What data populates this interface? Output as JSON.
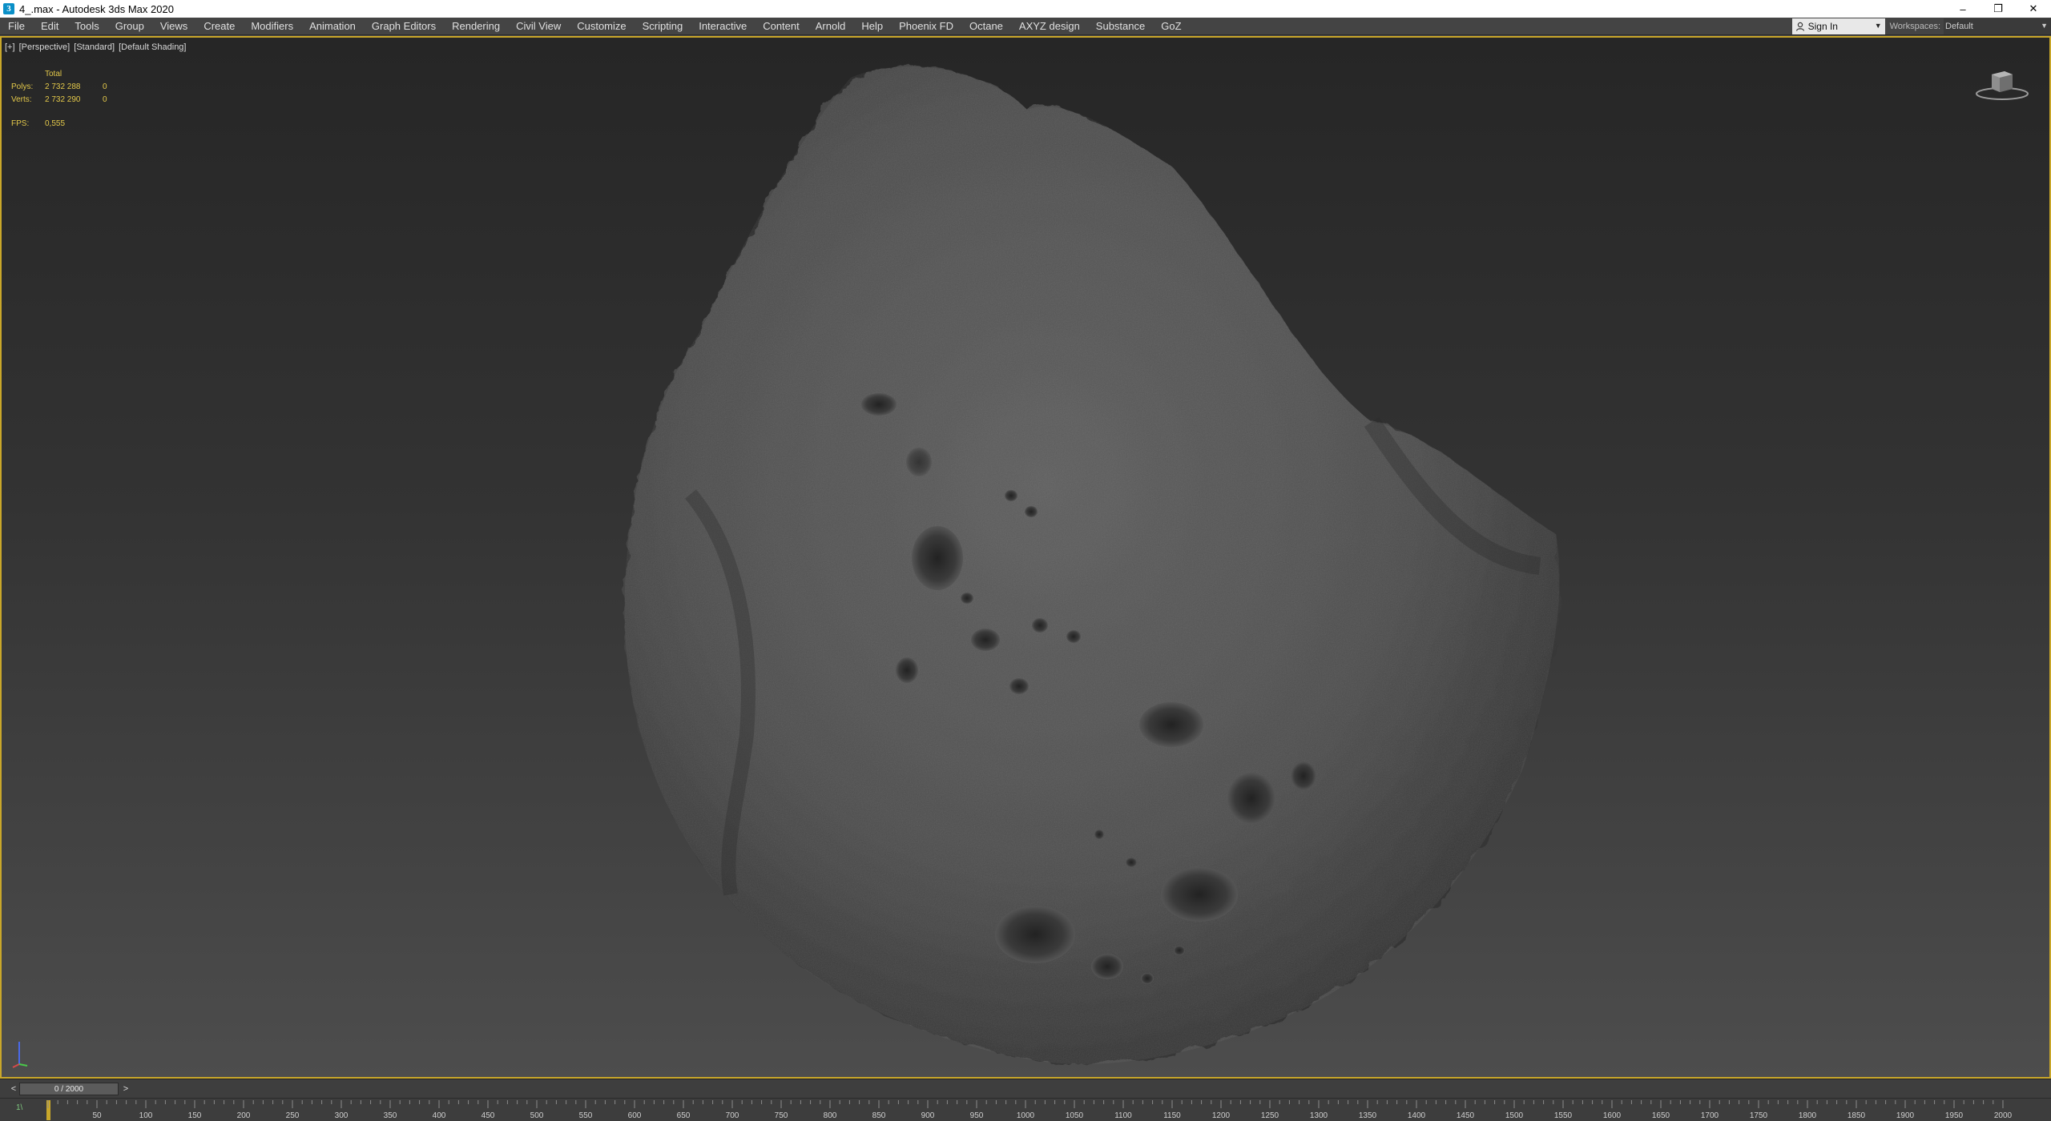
{
  "window": {
    "title": "4_.max - Autodesk 3ds Max 2020",
    "app_icon_glyph": "3",
    "controls": {
      "minimize": "–",
      "restore": "❐",
      "close": "✕"
    }
  },
  "menubar": {
    "items": [
      "File",
      "Edit",
      "Tools",
      "Group",
      "Views",
      "Create",
      "Modifiers",
      "Animation",
      "Graph Editors",
      "Rendering",
      "Civil View",
      "Customize",
      "Scripting",
      "Interactive",
      "Content",
      "Arnold",
      "Help",
      "Phoenix FD",
      "Octane",
      "AXYZ design",
      "Substance",
      "GoZ"
    ],
    "signin_label": "Sign In",
    "workspace_label": "Workspaces:",
    "workspace_value": "Default"
  },
  "viewport": {
    "label_parts": [
      "[+]",
      "[Perspective]",
      "[Standard]",
      "[Default Shading]"
    ],
    "stats": {
      "header": "Total",
      "polys_label": "Polys:",
      "polys_total": "2 732 288",
      "polys_sel": "0",
      "verts_label": "Verts:",
      "verts_total": "2 732 290",
      "verts_sel": "0",
      "fps_label": "FPS:",
      "fps_value": "0,555"
    },
    "colors": {
      "active_border": "#c9a72a",
      "stats_text": "#e3c84a"
    }
  },
  "timeline": {
    "slider_text": "0 / 2000",
    "prev_glyph": "<",
    "next_glyph": ">",
    "ticks": [
      "50",
      "100",
      "150",
      "200",
      "250",
      "300",
      "350",
      "400",
      "450",
      "500",
      "550",
      "600",
      "650",
      "700",
      "750",
      "800",
      "850",
      "900",
      "950",
      "1000",
      "1050",
      "1100",
      "1150",
      "1200",
      "1250",
      "1300",
      "1350",
      "1400",
      "1450",
      "1500",
      "1550",
      "1600",
      "1650",
      "1700",
      "1750",
      "1800",
      "1850",
      "1900",
      "1950",
      "2000"
    ],
    "key_marker": "1\\"
  }
}
